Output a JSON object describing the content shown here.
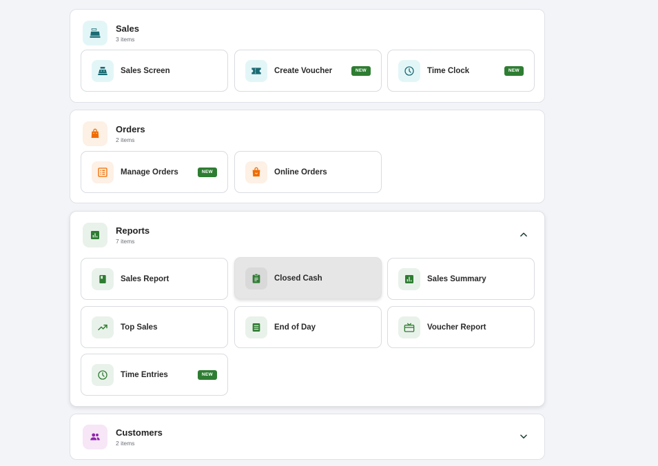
{
  "colors": {
    "sales_accent": "#1a6b73",
    "orders_accent": "#ef6c00",
    "reports_accent": "#2e7d32",
    "customers_accent": "#8e24aa",
    "badge_bg": "#2e7d32"
  },
  "sections": {
    "sales": {
      "title": "Sales",
      "count": "3 items",
      "icon": "cash-register-icon",
      "items": [
        {
          "label": "Sales Screen",
          "icon": "cash-register-icon",
          "badge": ""
        },
        {
          "label": "Create Voucher",
          "icon": "ticket-icon",
          "badge": "NEW"
        },
        {
          "label": "Time Clock",
          "icon": "clock-icon",
          "badge": "NEW"
        }
      ]
    },
    "orders": {
      "title": "Orders",
      "count": "2 items",
      "icon": "shopping-bag-icon",
      "items": [
        {
          "label": "Manage Orders",
          "icon": "order-list-icon",
          "badge": "NEW"
        },
        {
          "label": "Online Orders",
          "icon": "shopping-bag-icon",
          "badge": ""
        }
      ]
    },
    "reports": {
      "title": "Reports",
      "count": "7 items",
      "icon": "bar-chart-icon",
      "expanded": true,
      "items": [
        {
          "label": "Sales Report",
          "icon": "book-icon",
          "badge": ""
        },
        {
          "label": "Closed Cash",
          "icon": "clipboard-icon",
          "badge": "",
          "active": true
        },
        {
          "label": "Sales Summary",
          "icon": "bar-chart-icon",
          "badge": ""
        },
        {
          "label": "Top Sales",
          "icon": "trending-up-icon",
          "badge": ""
        },
        {
          "label": "End of Day",
          "icon": "document-list-icon",
          "badge": ""
        },
        {
          "label": "Voucher Report",
          "icon": "gift-card-icon",
          "badge": ""
        },
        {
          "label": "Time Entries",
          "icon": "clock-icon",
          "badge": "NEW"
        }
      ]
    },
    "customers": {
      "title": "Customers",
      "count": "2 items",
      "icon": "people-icon",
      "expanded": false
    }
  }
}
